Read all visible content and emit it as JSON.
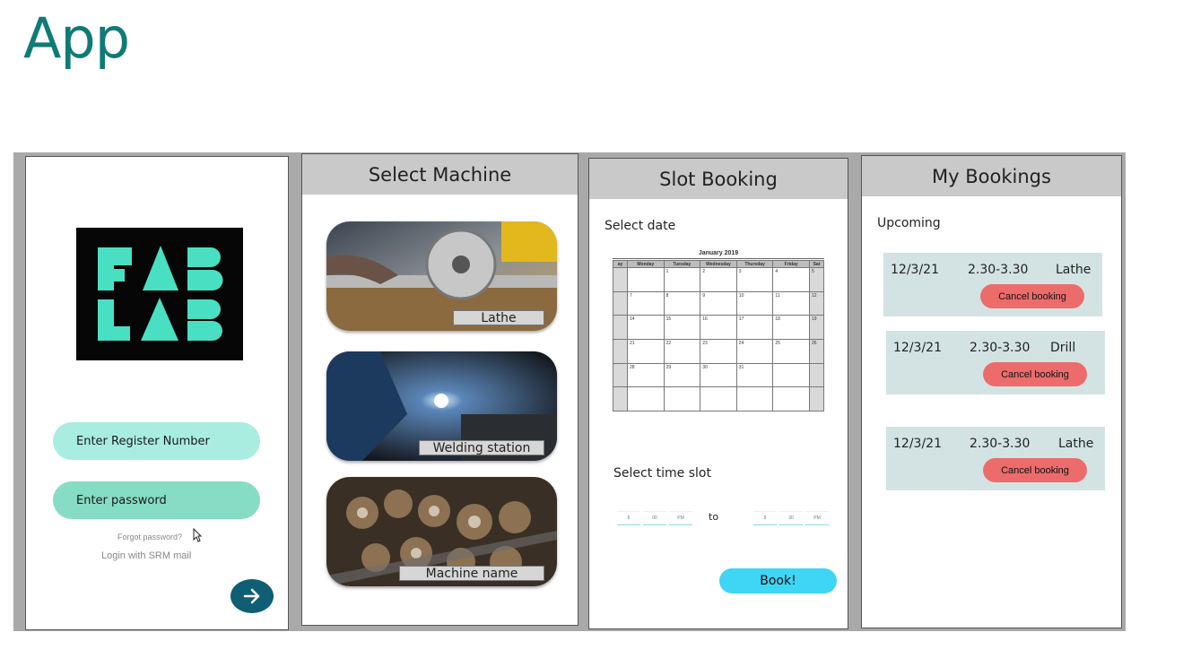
{
  "slide_title": "App",
  "login": {
    "logo_text": "FAB LAB",
    "register_placeholder": "Enter Register Number",
    "password_placeholder": "Enter password",
    "forgot_link": "Forgot password?",
    "srm_link": "Login with SRM mail",
    "submit_icon": "arrow-right-icon"
  },
  "select_machine": {
    "title": "Select Machine",
    "machines": [
      {
        "name": "Lathe"
      },
      {
        "name": "Welding station"
      },
      {
        "name": "Machine name"
      }
    ]
  },
  "slot_booking": {
    "title": "Slot Booking",
    "select_date_label": "Select date",
    "calendar": {
      "month": "January 2019",
      "weekdays": [
        "ay",
        "Monday",
        "Tuesday",
        "Wednesday",
        "Thursday",
        "Friday",
        "Sat"
      ],
      "rows": [
        [
          "",
          "",
          "1",
          "2",
          "3",
          "4",
          "5"
        ],
        [
          "",
          "7",
          "8",
          "9",
          "10",
          "11",
          "12"
        ],
        [
          "",
          "14",
          "15",
          "16",
          "17",
          "18",
          "19"
        ],
        [
          "",
          "21",
          "22",
          "23",
          "24",
          "25",
          "26"
        ],
        [
          "",
          "28",
          "29",
          "30",
          "31",
          "",
          ""
        ],
        [
          "",
          "",
          "",
          "",
          "",
          "",
          ""
        ]
      ]
    },
    "select_time_label": "Select time slot",
    "from": {
      "hour": "6",
      "minute": "00",
      "ampm": "PM"
    },
    "to_label": "to",
    "to": {
      "hour": "9",
      "minute": "30",
      "ampm": "PM"
    },
    "book_button": "Book!"
  },
  "my_bookings": {
    "title": "My Bookings",
    "section_label": "Upcoming",
    "bookings": [
      {
        "date": "12/3/21",
        "time": "2.30-3.30",
        "machine": "Lathe",
        "cancel": "Cancel booking"
      },
      {
        "date": "12/3/21",
        "time": "2.30-3.30",
        "machine": "Drill",
        "cancel": "Cancel booking"
      },
      {
        "date": "12/3/21",
        "time": "2.30-3.30",
        "machine": "Lathe",
        "cancel": "Cancel booking"
      }
    ]
  },
  "colors": {
    "title_teal": "#0f7b77",
    "field_1": "#a8ede0",
    "field_2": "#86dcc4",
    "submit": "#0f5e73",
    "logo_mint": "#49dfc2",
    "book_button": "#3fd5f5",
    "cancel_button": "#ec6c6c",
    "booking_card": "#d3e3e3"
  }
}
